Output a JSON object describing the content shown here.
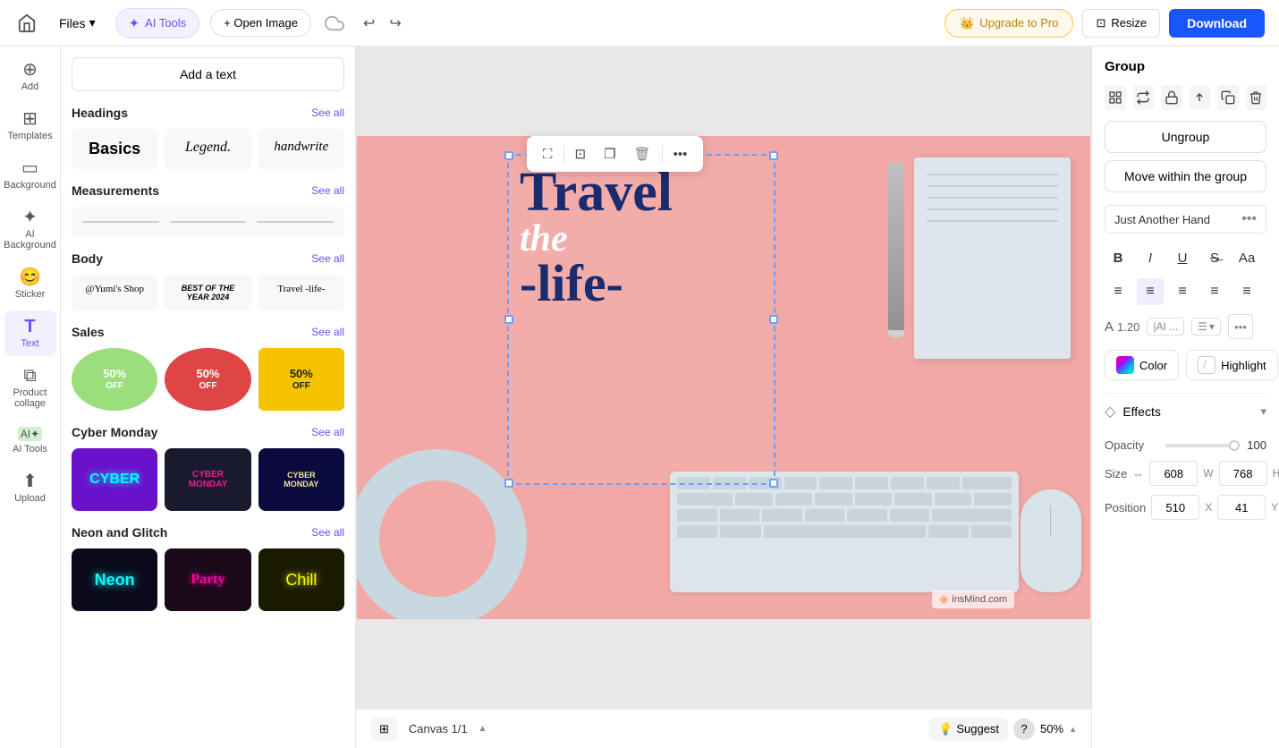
{
  "topbar": {
    "home_icon": "🏠",
    "files_label": "Files",
    "ai_tools_label": "AI Tools",
    "open_image_label": "+ Open Image",
    "undo_icon": "↩",
    "redo_icon": "↪",
    "upgrade_label": "Upgrade to Pro",
    "resize_label": "Resize",
    "download_label": "Download"
  },
  "left_sidebar": {
    "items": [
      {
        "id": "add",
        "icon": "+",
        "label": "Add"
      },
      {
        "id": "templates",
        "icon": "⊞",
        "label": "Templates"
      },
      {
        "id": "background",
        "icon": "▭",
        "label": "Background"
      },
      {
        "id": "ai-background",
        "icon": "✦",
        "label": "AI Background"
      },
      {
        "id": "sticker",
        "icon": "😊",
        "label": "Sticker"
      },
      {
        "id": "text",
        "icon": "T",
        "label": "Text",
        "active": true
      },
      {
        "id": "product-collage",
        "icon": "⧉",
        "label": "Product collage"
      },
      {
        "id": "ai-tools",
        "icon": "🤖",
        "label": "AI Tools"
      },
      {
        "id": "upload",
        "icon": "⬆",
        "label": "Upload"
      }
    ]
  },
  "panel": {
    "add_text_label": "Add a text",
    "headings": {
      "title": "Headings",
      "see_all": "See all",
      "fonts": [
        {
          "id": "basics",
          "label": "Basics",
          "style": "bold"
        },
        {
          "id": "legend",
          "label": "Legend.",
          "style": "italic"
        },
        {
          "id": "handwrite",
          "label": "handwrite",
          "style": "handwrite"
        }
      ]
    },
    "measurements": {
      "title": "Measurements",
      "see_all": "See all"
    },
    "body": {
      "title": "Body",
      "see_all": "See all",
      "samples": [
        {
          "id": "yumis-shop",
          "label": "@Yumi's Shop"
        },
        {
          "id": "best-of-year",
          "label": "BEST OF THE YEAR 2024"
        },
        {
          "id": "travel-life",
          "label": "Travel -life-"
        }
      ]
    },
    "sales": {
      "title": "Sales",
      "see_all": "See all",
      "items": [
        {
          "id": "sale1",
          "label": "50% OFF",
          "bg": "#9bde7e",
          "color": "#fff"
        },
        {
          "id": "sale2",
          "label": "50% OFF",
          "bg": "#e04545",
          "color": "#fff"
        },
        {
          "id": "sale3",
          "label": "50% OFF",
          "bg": "#f5c400",
          "color": "#222"
        }
      ]
    },
    "cyber_monday": {
      "title": "Cyber Monday",
      "see_all": "See all",
      "items": [
        {
          "id": "cyber1",
          "label": "CYBER",
          "bg": "#6a11cb",
          "color": "#0ff"
        },
        {
          "id": "cyber2",
          "label": "CYBER MONDAY",
          "bg": "#1a1a2e",
          "color": "#e91e8c"
        },
        {
          "id": "cyber3",
          "label": "CYBER MONDAY",
          "bg": "#0a0a3e",
          "color": "#ffe"
        }
      ]
    },
    "neon_glitch": {
      "title": "Neon and Glitch",
      "see_all": "See all",
      "items": [
        {
          "id": "neon1",
          "label": "Neon",
          "bg": "#0a0a1a",
          "color": "#0ff"
        },
        {
          "id": "neon2",
          "label": "Party",
          "bg": "#1a0a1a",
          "color": "#f0a"
        },
        {
          "id": "neon3",
          "label": "Chill",
          "bg": "#1a1a00",
          "color": "#ff0"
        }
      ]
    }
  },
  "canvas": {
    "text_content": "Travel\nthe\n-life-",
    "name": "Canvas 1/1",
    "zoom": "50%",
    "toolbar": {
      "fullscreen_icon": "⛶",
      "crop_icon": "⊡",
      "duplicate_icon": "❐",
      "delete_icon": "🗑",
      "more_icon": "•••"
    },
    "watermark": "insMind.com"
  },
  "right_panel": {
    "group_title": "Group",
    "group_icons": [
      "⊞",
      "✦",
      "🔒",
      "↑",
      "❐",
      "🗑"
    ],
    "ungroup_label": "Ungroup",
    "move_within_label": "Move within the group",
    "font_name": "Just Another Hand",
    "font_more": "•••",
    "format": {
      "bold": "B",
      "italic": "I",
      "underline": "U",
      "strikethrough": "S̶",
      "case": "Aa"
    },
    "align": {
      "left": "≡",
      "center": "≡",
      "right": "≡",
      "justify": "≡",
      "mixed": "≡"
    },
    "text_size_icon": "A",
    "text_size_val": "1.20",
    "ai_label": "|AI ...",
    "list_label": "☰",
    "color_label": "Color",
    "highlight_label": "Highlight",
    "effects_label": "Effects",
    "effects_icon": "◇",
    "opacity_label": "Opacity",
    "opacity_val": "100",
    "size_label": "Size",
    "size_w": "608",
    "size_h": "768",
    "size_link_icon": "⇔",
    "w_label": "W",
    "h_label": "H",
    "position_label": "Position",
    "position_x": "510",
    "position_y": "41",
    "x_label": "X",
    "y_label": "Y"
  },
  "canvas_bottom": {
    "layers_icon": "⊞",
    "canvas_name": "Canvas 1/1",
    "chevron_up": "▲",
    "zoom": "50%",
    "zoom_up": "▲",
    "suggest_label": "Suggest",
    "help_label": "?"
  }
}
